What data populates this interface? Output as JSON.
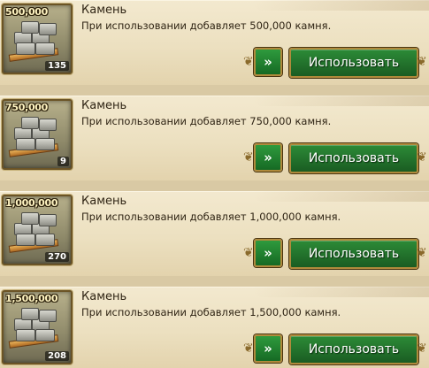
{
  "items": [
    {
      "name": "Камень",
      "description": "При использовании добавляет 500,000 камня.",
      "amount_label": "500,000",
      "quantity": "135",
      "use_label": "Использовать",
      "more_label": "»"
    },
    {
      "name": "Камень",
      "description": "При использовании добавляет 750,000 камня.",
      "amount_label": "750,000",
      "quantity": "9",
      "use_label": "Использовать",
      "more_label": "»"
    },
    {
      "name": "Камень",
      "description": "При использовании добавляет 1,000,000 камня.",
      "amount_label": "1,000,000",
      "quantity": "270",
      "use_label": "Использовать",
      "more_label": "»"
    },
    {
      "name": "Камень",
      "description": "При использовании добавляет 1,500,000 камня.",
      "amount_label": "1,500,000",
      "quantity": "208",
      "use_label": "Использовать",
      "more_label": "»"
    }
  ],
  "colors": {
    "button_green": "#1f6f2a",
    "frame_gold": "#b08a3c",
    "parchment": "#ece0c0"
  },
  "icons": {
    "item": "stone-pile-icon",
    "more": "double-chevron-right-icon"
  }
}
